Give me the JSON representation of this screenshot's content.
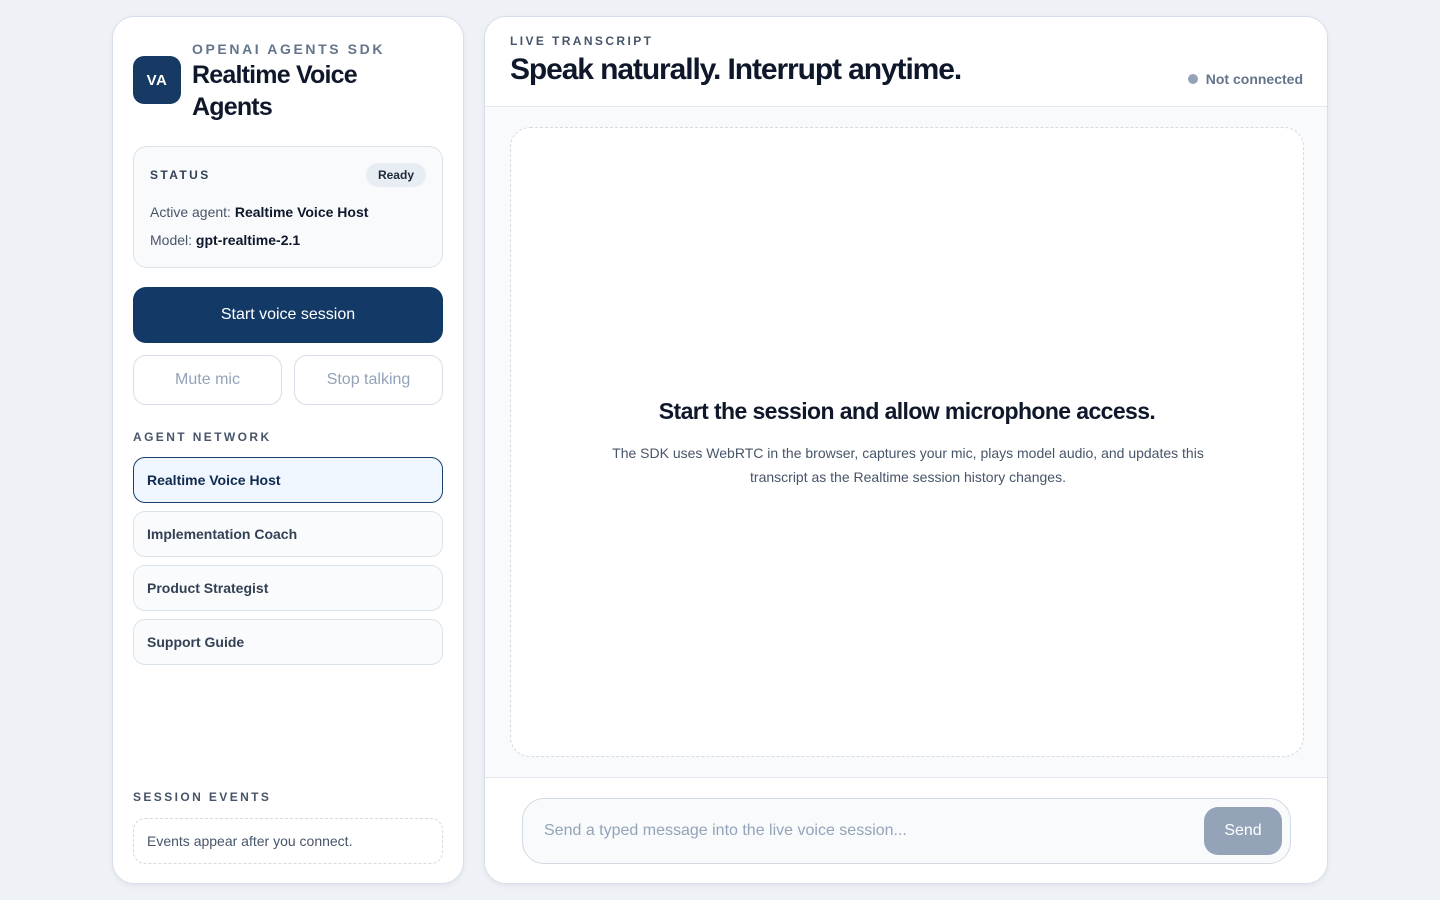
{
  "sidebar": {
    "brand": {
      "logo_text": "VA",
      "eyebrow": "OPENAI AGENTS SDK",
      "title": "Realtime Voice Agents"
    },
    "status": {
      "label": "STATUS",
      "badge": "Ready",
      "active_agent_label": "Active agent:",
      "active_agent_value": "Realtime Voice Host",
      "model_label": "Model:",
      "model_value": "gpt-realtime-2.1"
    },
    "actions": {
      "start_label": "Start voice session",
      "mute_label": "Mute mic",
      "stop_label": "Stop talking"
    },
    "agent_network": {
      "label": "AGENT NETWORK",
      "items": [
        {
          "label": "Realtime Voice Host",
          "active": true
        },
        {
          "label": "Implementation Coach",
          "active": false
        },
        {
          "label": "Product Strategist",
          "active": false
        },
        {
          "label": "Support Guide",
          "active": false
        }
      ]
    },
    "session_events": {
      "label": "SESSION EVENTS",
      "empty_text": "Events appear after you connect."
    }
  },
  "main": {
    "eyebrow": "LIVE TRANSCRIPT",
    "title": "Speak naturally. Interrupt anytime.",
    "connection_status": "Not connected",
    "empty_state": {
      "title": "Start the session and allow microphone access.",
      "description": "The SDK uses WebRTC in the browser, captures your mic, plays model audio, and updates this transcript as the Realtime session history changes."
    },
    "composer": {
      "placeholder": "Send a typed message into the live voice session...",
      "value": "",
      "send_label": "Send"
    }
  },
  "colors": {
    "page_background": "#eef1f5",
    "primary": "#133a66",
    "active_agent_background": "#eff6ff",
    "muted_text": "#94a3b8",
    "status_dot": "#94a3b8"
  }
}
